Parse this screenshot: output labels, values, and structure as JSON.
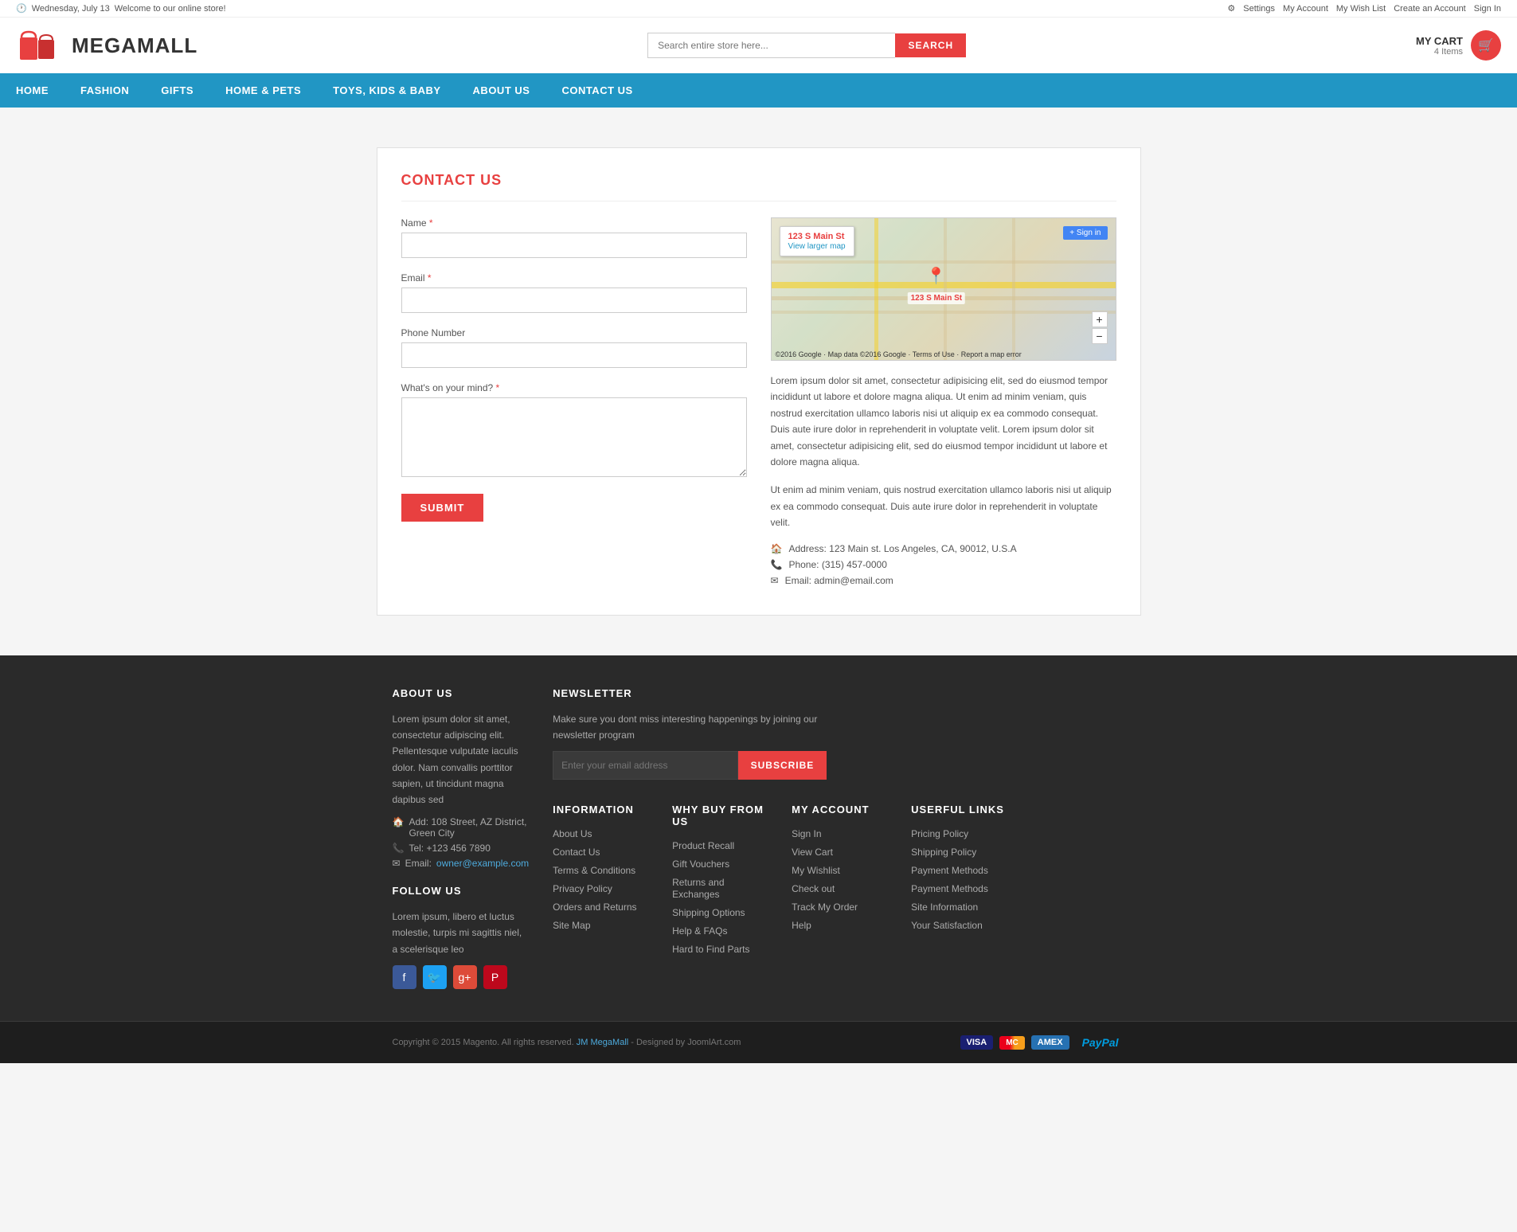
{
  "topbar": {
    "date": "Wednesday, July 13",
    "welcome": "Welcome to our online store!",
    "settings": "Settings",
    "myaccount": "My Account",
    "wishlist": "My Wish List",
    "create": "Create an Account",
    "signin": "Sign In"
  },
  "header": {
    "logo_text": "MEGAMALL",
    "search_placeholder": "Search entire store here...",
    "search_label": "SEARCH",
    "cart_label": "MY CART",
    "cart_items": "4 Items"
  },
  "nav": {
    "items": [
      {
        "label": "HOME",
        "active": true
      },
      {
        "label": "FASHION"
      },
      {
        "label": "GIFTS"
      },
      {
        "label": "HOME & PETS"
      },
      {
        "label": "TOYS, KIDS & BABY"
      },
      {
        "label": "ABOUT US"
      },
      {
        "label": "CONTACT US"
      }
    ]
  },
  "contact_page": {
    "title": "CONTACT US",
    "form": {
      "name_label": "Name",
      "name_required": "*",
      "email_label": "Email",
      "email_required": "*",
      "phone_label": "Phone Number",
      "mind_label": "What's on your mind?",
      "mind_required": "*",
      "submit_label": "SUBMIT"
    },
    "map": {
      "address_popup": "123 S Main St",
      "view_larger": "View larger map",
      "signin": "+ Sign in",
      "address_pin": "123 S Main St",
      "credit": "©2016 Google · Map data ©2016 Google · Terms of Use · Report a map error"
    },
    "info_text_1": "Lorem ipsum dolor sit amet, consectetur adipisicing elit, sed do eiusmod tempor incididunt ut labore et dolore magna aliqua. Ut enim ad minim veniam, quis nostrud exercitation ullamco laboris nisi ut aliquip ex ea commodo consequat. Duis aute irure dolor in reprehenderit in voluptate velit. Lorem ipsum dolor sit amet, consectetur adipisicing elit, sed do eiusmod tempor incididunt ut labore et dolore magna aliqua.",
    "info_text_2": "Ut enim ad minim veniam, quis nostrud exercitation ullamco laboris nisi ut aliquip ex ea commodo consequat. Duis aute irure dolor in reprehenderit in voluptate velit.",
    "address": "Address: 123 Main st. Los Angeles, CA, 90012, U.S.A",
    "phone": "Phone: (315) 457-0000",
    "email": "Email: admin@email.com"
  },
  "footer": {
    "about": {
      "title": "ABOUT US",
      "text": "Lorem ipsum dolor sit amet, consectetur adipiscing elit. Pellentesque vulputate iaculis dolor. Nam convallis porttitor sapien, ut tincidunt magna dapibus sed",
      "address": "Add: 108 Street, AZ District, Green City",
      "tel": "Tel: +123 456 7890",
      "email": "owner@example.com",
      "email_label": "Email:"
    },
    "follow": {
      "title": "FOLLOW US",
      "text": "Lorem ipsum, libero et luctus molestie, turpis mi sagittis niel, a scelerisque leo"
    },
    "newsletter": {
      "title": "NEWSLETTER",
      "text": "Make sure you dont miss interesting happenings by joining our newsletter program",
      "placeholder": "Enter your email address",
      "btn_label": "SUBSCRIBE"
    },
    "information": {
      "title": "INFORMATION",
      "links": [
        "About Us",
        "Contact Us",
        "Terms & Conditions",
        "Privacy Policy",
        "Orders and Returns",
        "Site Map"
      ]
    },
    "why_buy": {
      "title": "WHY BUY FROM US",
      "links": [
        "Product Recall",
        "Gift Vouchers",
        "Returns and Exchanges",
        "Shipping Options",
        "Help & FAQs",
        "Hard to Find Parts"
      ]
    },
    "my_account": {
      "title": "MY ACCOUNT",
      "links": [
        "Sign In",
        "View Cart",
        "My Wishlist",
        "Check out",
        "Track My Order",
        "Help"
      ]
    },
    "useful_links": {
      "title": "USERFUL LINKS",
      "links": [
        "Pricing Policy",
        "Shipping Policy",
        "Payment Methods",
        "Payment Methods",
        "Site Information",
        "Your Satisfaction"
      ]
    },
    "copyright": "Copyright © 2015 Magento. All rights reserved.",
    "brand": "JM MegaMall",
    "designed": "- Designed by JoomlArt.com",
    "payment_methods": [
      "VISA",
      "MC",
      "AMEX",
      "PayPal"
    ]
  }
}
